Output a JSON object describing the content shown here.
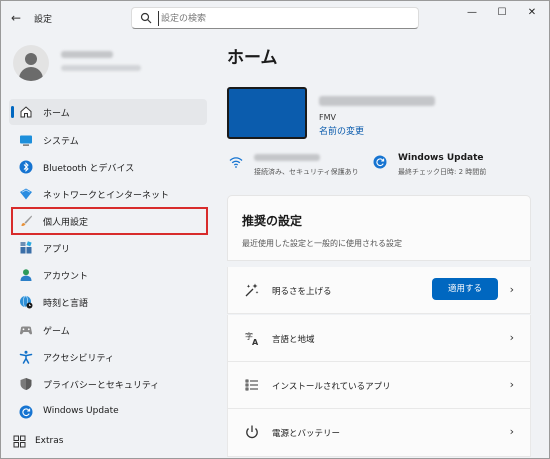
{
  "window": {
    "back_glyph": "←",
    "title": "設定",
    "controls": [
      "—",
      "☐",
      "✕"
    ]
  },
  "search": {
    "placeholder": "設定の検索"
  },
  "sidebar": {
    "items": [
      {
        "label": "ホーム",
        "icon": "home-icon",
        "active": true
      },
      {
        "label": "システム",
        "icon": "monitor-icon"
      },
      {
        "label": "Bluetooth とデバイス",
        "icon": "bluetooth-icon"
      },
      {
        "label": "ネットワークとインターネット",
        "icon": "wifi-diamond-icon"
      },
      {
        "label": "個人用設定",
        "icon": "brush-icon"
      },
      {
        "label": "アプリ",
        "icon": "apps-icon"
      },
      {
        "label": "アカウント",
        "icon": "person-icon"
      },
      {
        "label": "時刻と言語",
        "icon": "globe-clock-icon"
      },
      {
        "label": "ゲーム",
        "icon": "gamepad-icon"
      },
      {
        "label": "アクセシビリティ",
        "icon": "accessibility-icon"
      },
      {
        "label": "プライバシーとセキュリティ",
        "icon": "shield-icon"
      },
      {
        "label": "Windows Update",
        "icon": "update-icon"
      }
    ],
    "extras_label": "Extras"
  },
  "main": {
    "title": "ホーム",
    "device": {
      "model": "FMV",
      "rename_link": "名前の変更"
    },
    "windows_update": {
      "title": "Windows Update",
      "subtitle": "最終チェック日時: 2 時間前"
    },
    "wifi_status": {
      "subtitle": "接続済み、セキュリティ保護あり"
    },
    "recommended": {
      "title": "推奨の設定",
      "subtitle": "最近使用した設定と一般的に使用される設定",
      "rows": [
        {
          "label": "明るさを上げる",
          "icon": "sparkle-wand-icon",
          "button": "適用する"
        },
        {
          "label": "言語と地域",
          "icon": "language-icon"
        },
        {
          "label": "インストールされているアプリ",
          "icon": "list-icon"
        },
        {
          "label": "電源とバッテリー",
          "icon": "power-icon"
        }
      ]
    }
  },
  "colors": {
    "accent": "#0067c0",
    "highlight": "#d82b2b",
    "device": "#0b5cad"
  }
}
